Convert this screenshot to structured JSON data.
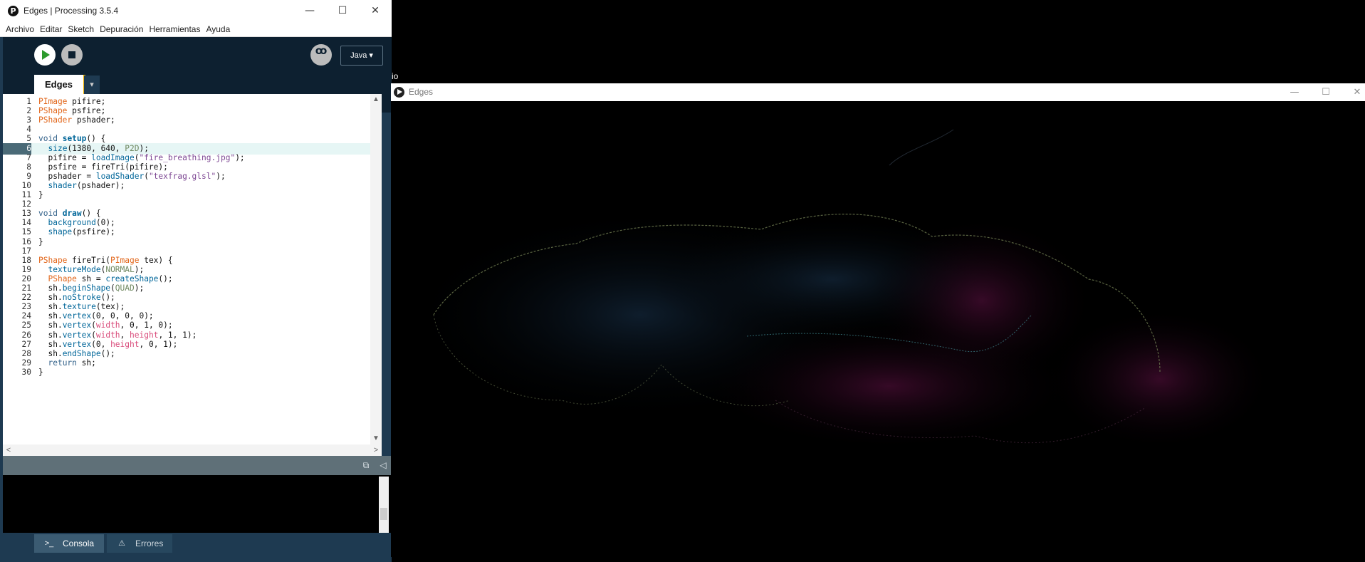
{
  "ide": {
    "title": "Edges | Processing 3.5.4",
    "app_icon": "P",
    "window_controls": {
      "minimize": "—",
      "maximize": "☐",
      "close": "✕"
    },
    "menu": [
      "Archivo",
      "Editar",
      "Sketch",
      "Depuración",
      "Herramientas",
      "Ayuda"
    ],
    "toolbar": {
      "debug_symbol": "ꝏ",
      "mode": "Java ▾"
    },
    "tab": {
      "name": "Edges",
      "menu_arrow": "▾"
    },
    "current_line": 6,
    "code_lines": [
      "PImage pifire;",
      "PShape psfire;",
      "PShader pshader;",
      "",
      "void setup() {",
      "  size(1380, 640, P2D);",
      "  pifire = loadImage(\"fire_breathing.jpg\");",
      "  psfire = fireTri(pifire);",
      "  pshader = loadShader(\"texfrag.glsl\");",
      "  shader(pshader);",
      "}",
      "",
      "void draw() {",
      "  background(0);",
      "  shape(psfire);",
      "}",
      "",
      "PShape fireTri(PImage tex) {",
      "  textureMode(NORMAL);",
      "  PShape sh = createShape();",
      "  sh.beginShape(QUAD);",
      "  sh.noStroke();",
      "  sh.texture(tex);",
      "  sh.vertex(0, 0, 0, 0);",
      "  sh.vertex(width, 0, 1, 0);",
      "  sh.vertex(width, height, 1, 1);",
      "  sh.vertex(0, height, 0, 1);",
      "  sh.endShape();",
      "  return sh;",
      "}"
    ],
    "scroll": {
      "up": "▲",
      "down": "▼",
      "left": "<",
      "right": ">"
    },
    "console_header_icons": {
      "copy": "⧉",
      "collapse": "◁"
    },
    "footer_tabs": [
      {
        "label": "Consola",
        "icon": ">_"
      },
      {
        "label": "Errores",
        "icon": "⚠"
      }
    ]
  },
  "sketch": {
    "title": "Edges",
    "window_controls": {
      "minimize": "—",
      "maximize": "☐",
      "close": "✕"
    }
  },
  "stray_text": "io"
}
